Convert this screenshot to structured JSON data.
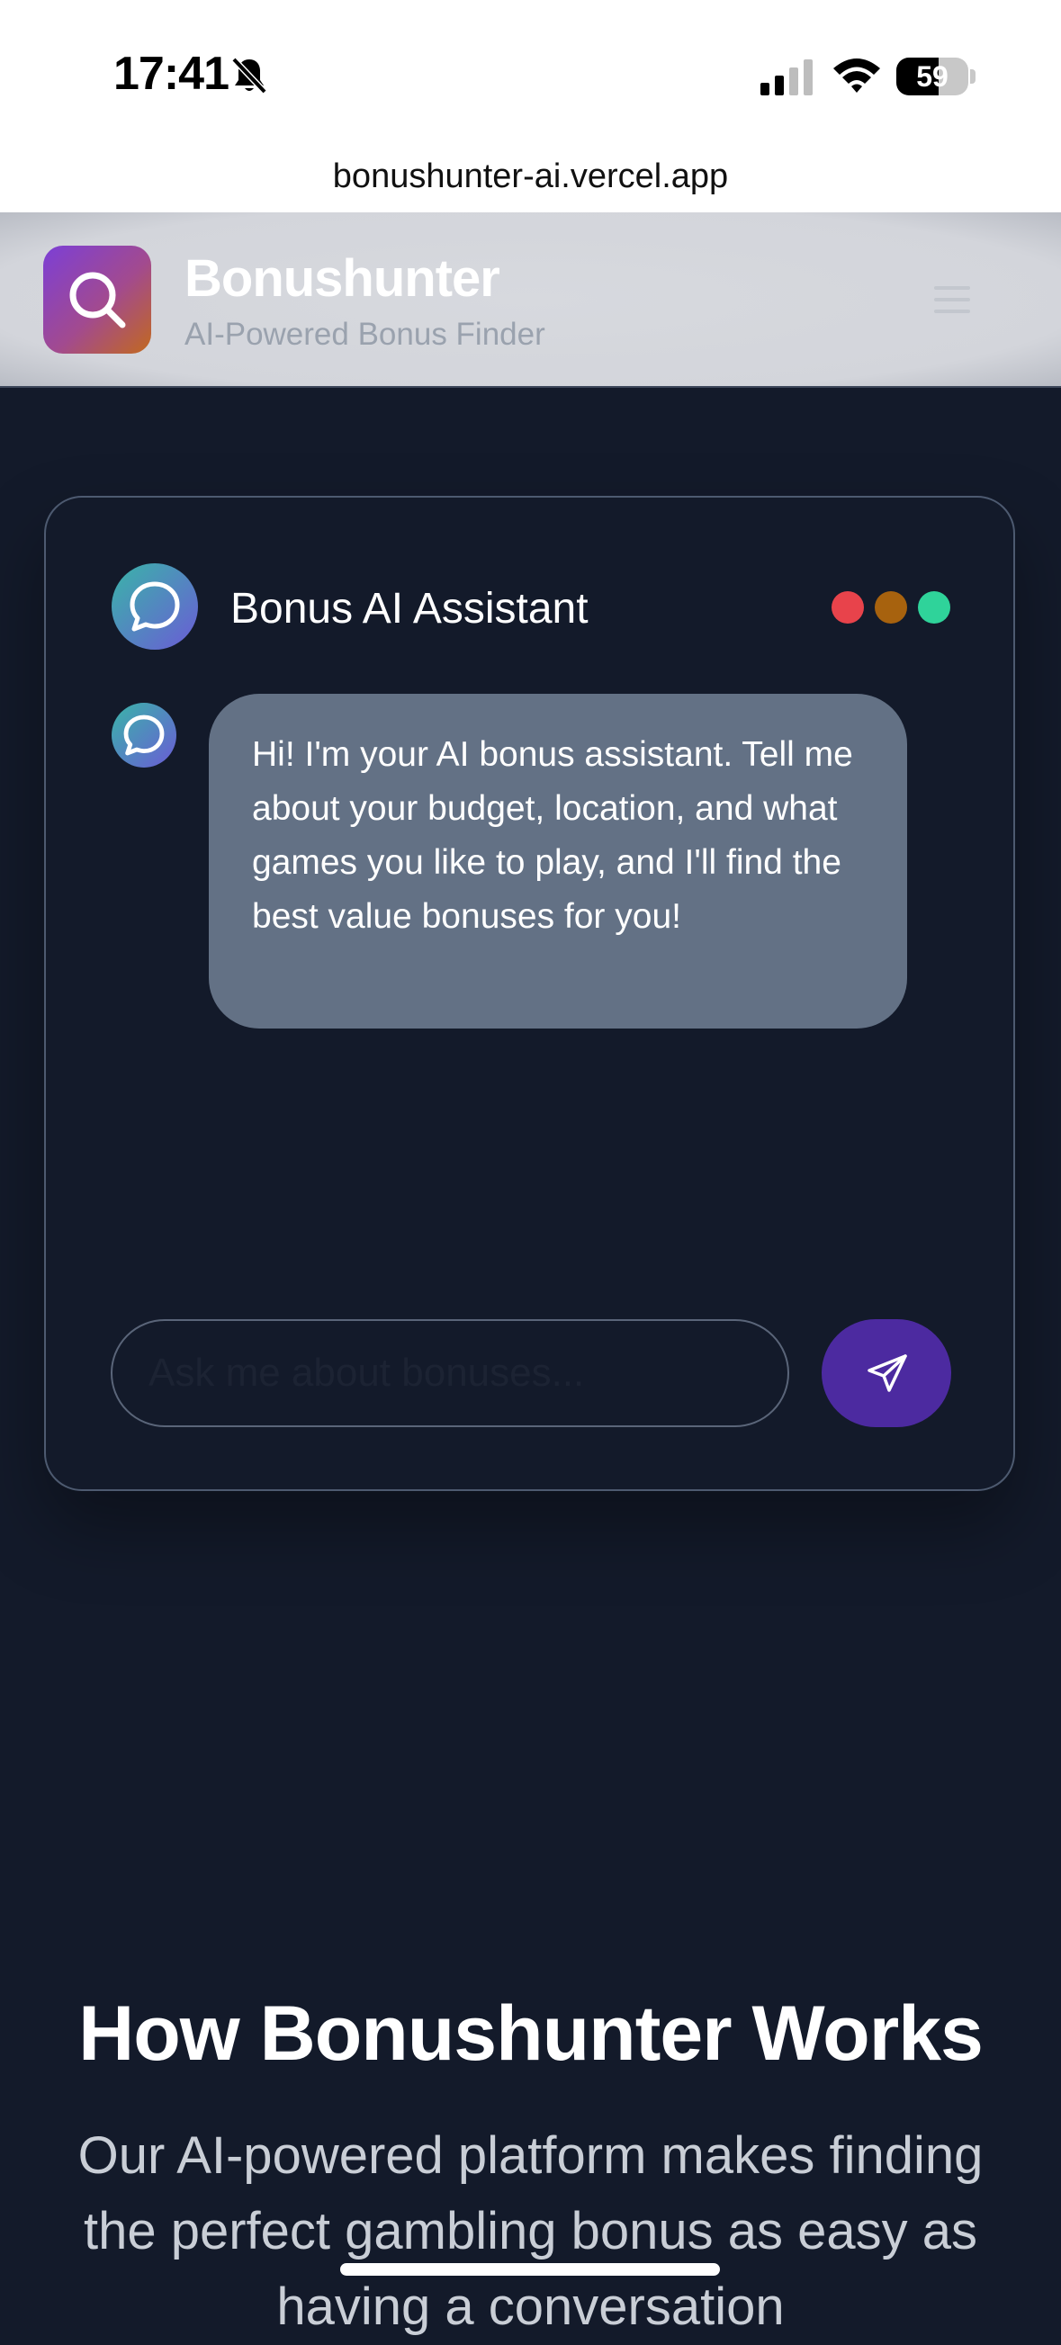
{
  "status_bar": {
    "time": "17:41",
    "battery_level": "59",
    "battery_fraction": 0.59,
    "icons": [
      "bell-slash-icon",
      "signal-icon",
      "wifi-icon",
      "battery-icon"
    ]
  },
  "browser": {
    "url": "bonushunter-ai.vercel.app"
  },
  "header": {
    "title": "Bonushunter",
    "subtitle": "AI-Powered Bonus Finder",
    "logo_icon": "search-icon",
    "menu_icon": "hamburger-menu-icon"
  },
  "chat": {
    "title": "Bonus AI Assistant",
    "window_dots": [
      "#e8434b",
      "#a7620e",
      "#2fd39a"
    ],
    "messages": [
      {
        "sender": "assistant",
        "text": "Hi! I'm your AI bonus assistant. Tell me about your budget, location, and what games you like to play, and I'll find the best value bonuses for you!"
      }
    ],
    "input_placeholder": "Ask me about bonuses...",
    "input_value": "",
    "send_icon": "send-icon"
  },
  "how_it_works": {
    "title": "How Bonushunter Works",
    "description": "Our AI-powered platform makes finding the perfect gambling bonus as easy as having a conversation"
  },
  "colors": {
    "page_background": "#131a2a",
    "bubble_background": "#637185",
    "send_button": "#4c2aa0",
    "logo_gradient_start": "#7c3fd6",
    "logo_gradient_end": "#c2691e"
  }
}
